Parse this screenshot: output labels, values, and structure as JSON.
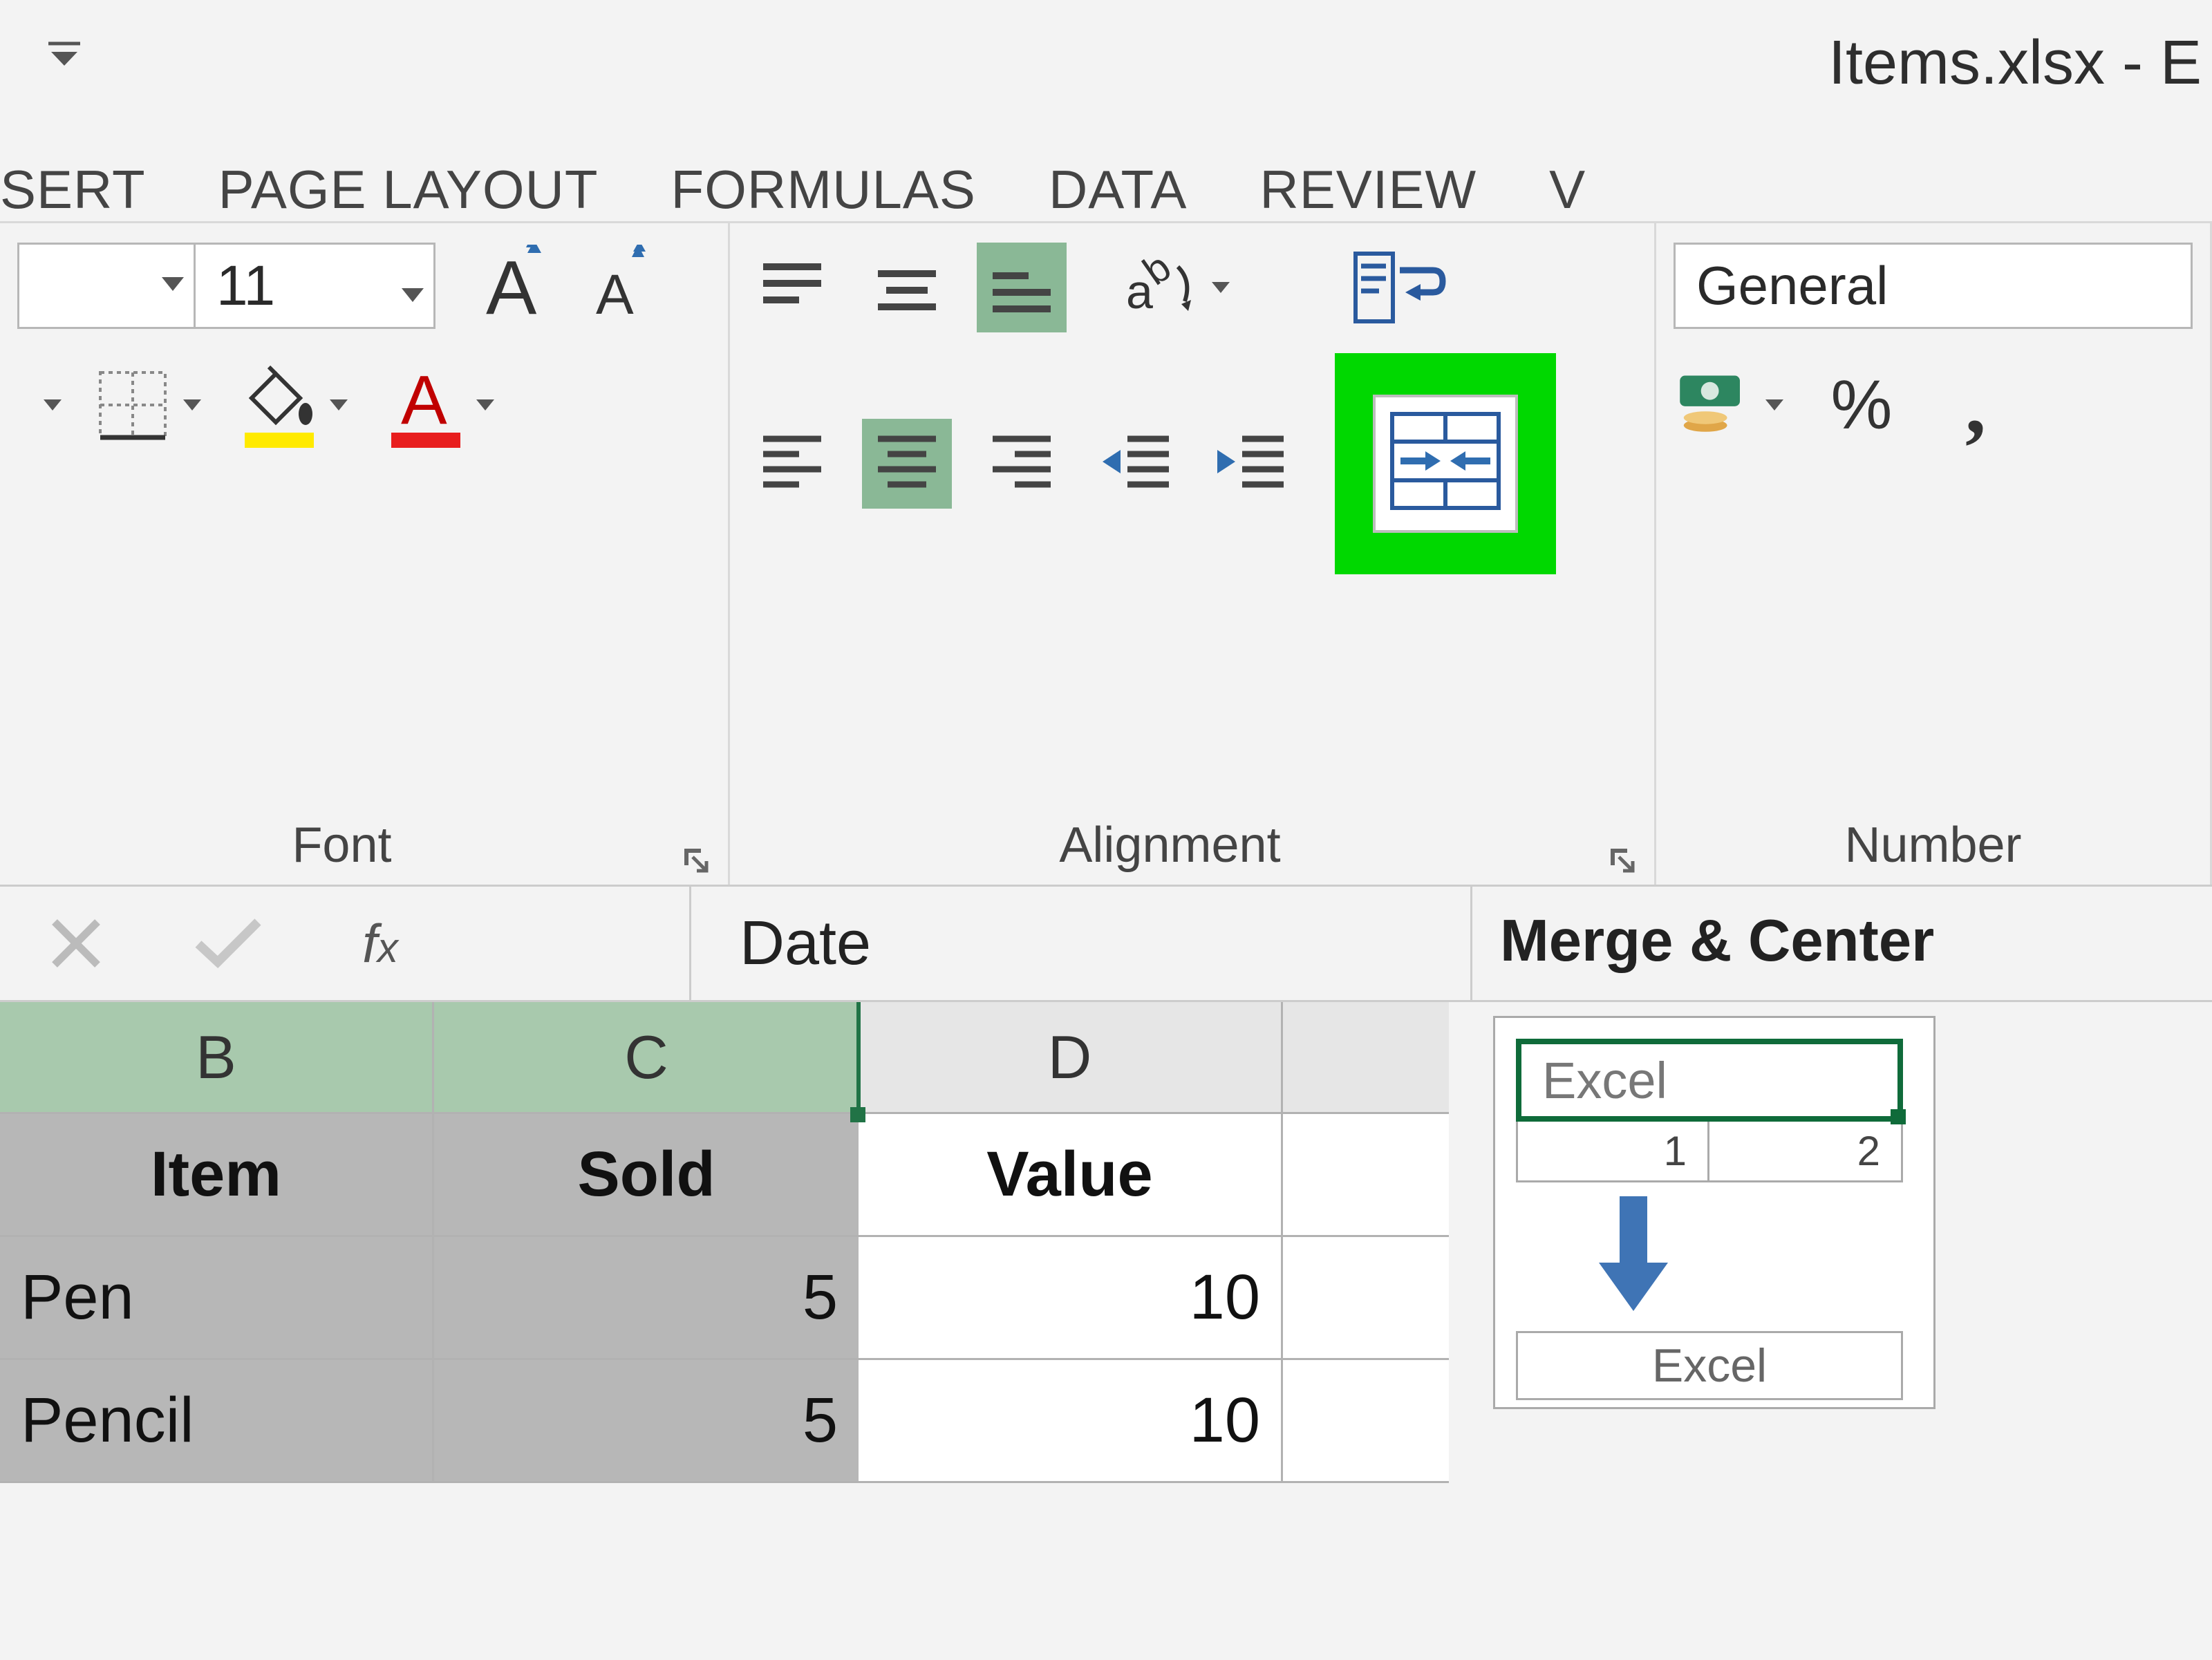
{
  "title": "Items.xlsx - E",
  "tabs": {
    "insert": "SERT",
    "page_layout": "PAGE LAYOUT",
    "formulas": "FORMULAS",
    "data": "DATA",
    "review": "REVIEW",
    "view": "V"
  },
  "ribbon": {
    "font": {
      "label": "Font",
      "size": "11"
    },
    "alignment": {
      "label": "Alignment"
    },
    "number": {
      "label": "Number",
      "format": "General"
    }
  },
  "formula_bar": {
    "value": "Date"
  },
  "tooltip": {
    "title": "Merge & Center",
    "example_text": "Excel",
    "sub1": "1",
    "sub2": "2",
    "bottom": "Excel"
  },
  "grid": {
    "cols": {
      "b": "B",
      "c": "C",
      "d": "D"
    },
    "rows": [
      {
        "b": "Item",
        "c": "Sold",
        "d": "Value",
        "is_header": true
      },
      {
        "b": "Pen",
        "c": "5",
        "d": "10"
      },
      {
        "b": "Pencil",
        "c": "5",
        "d": "10"
      }
    ]
  },
  "icons": {
    "percent": "%",
    "comma": ","
  }
}
